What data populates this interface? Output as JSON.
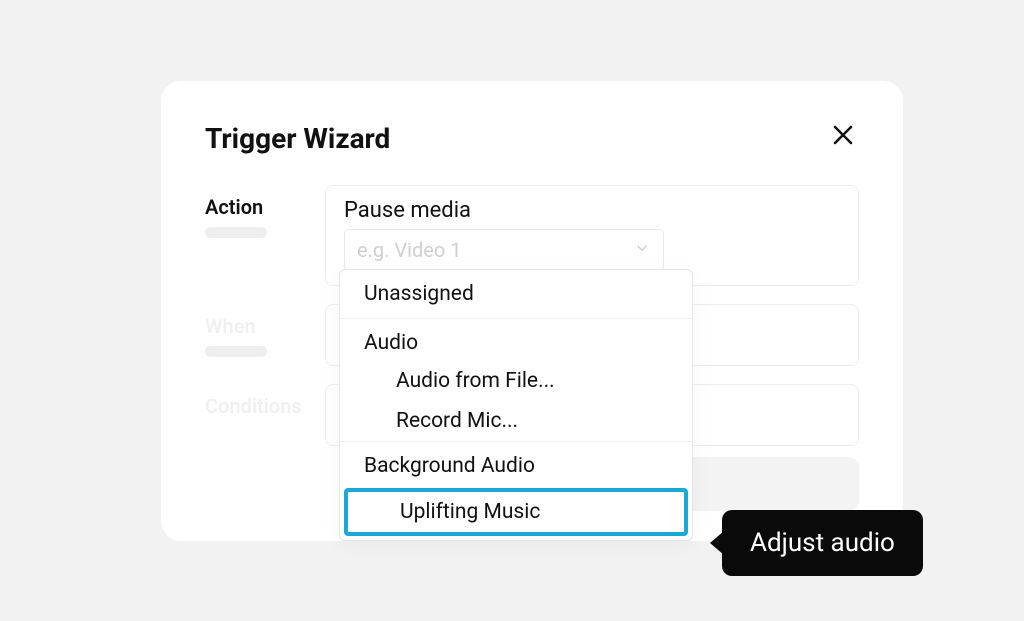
{
  "modal": {
    "title": "Trigger Wizard",
    "rows": {
      "action": {
        "label": "Action",
        "value": "Pause media",
        "select_placeholder": "e.g. Video 1"
      },
      "when": {
        "label": "When"
      },
      "conditions": {
        "label": "Conditions"
      }
    }
  },
  "dropdown": {
    "unassigned": "Unassigned",
    "audio_header": "Audio",
    "audio_from_file": "Audio from File...",
    "record_mic": "Record Mic...",
    "background_audio_header": "Background Audio",
    "uplifting_music": "Uplifting Music"
  },
  "tooltip": {
    "label": "Adjust audio"
  }
}
